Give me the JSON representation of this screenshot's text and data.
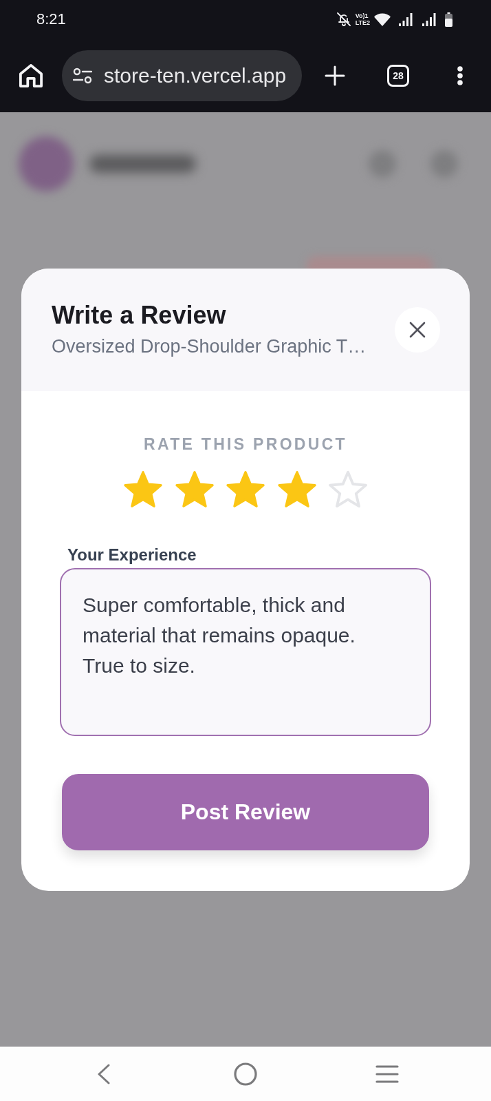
{
  "status_bar": {
    "time": "8:21",
    "network_top": "Vo)1",
    "network_bottom": "LTE2"
  },
  "browser_toolbar": {
    "url": "store-ten.vercel.app",
    "tab_count": "28"
  },
  "review_dialog": {
    "title": "Write a Review",
    "subtitle": "Oversized Drop-Shoulder Graphic T…",
    "rating_label": "RATE THIS PRODUCT",
    "stars": 4,
    "experience_field": {
      "label": "Your Experience",
      "value": "Super comfortable, thick and material that remains opaque. True to size."
    },
    "submit_button": "Post Review"
  }
}
